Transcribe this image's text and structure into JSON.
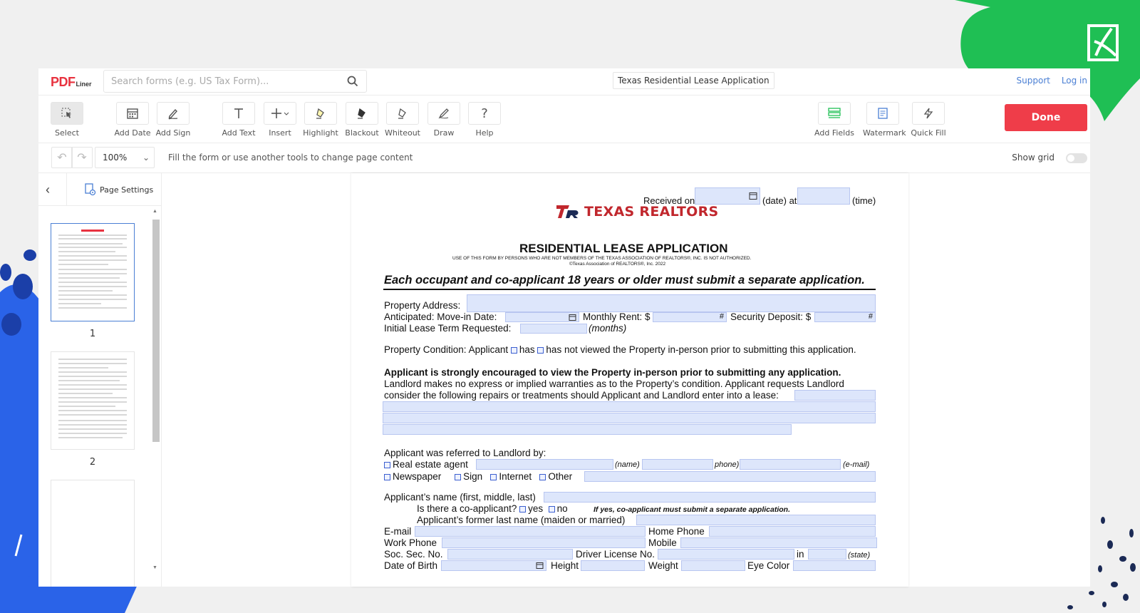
{
  "app": {
    "logo_main": "PDF",
    "logo_sub": "Liner",
    "search_placeholder": "Search forms (e.g. US Tax Form)...",
    "doc_title": "Texas Residential Lease Application",
    "links": [
      "Support",
      "Log in"
    ]
  },
  "toolbar": {
    "tools": [
      {
        "label": "Select",
        "icon": "select-icon"
      },
      {
        "label": "Add Date",
        "icon": "calendar-icon"
      },
      {
        "label": "Add Sign",
        "icon": "sign-icon"
      },
      {
        "label": "Add Text",
        "icon": "text-icon"
      },
      {
        "label": "Insert",
        "icon": "plus-icon"
      },
      {
        "label": "Highlight",
        "icon": "highlight-icon"
      },
      {
        "label": "Blackout",
        "icon": "blackout-icon"
      },
      {
        "label": "Whiteout",
        "icon": "whiteout-icon"
      },
      {
        "label": "Draw",
        "icon": "draw-icon"
      },
      {
        "label": "Help",
        "icon": "help-icon"
      },
      {
        "label": "Add Fields",
        "icon": "fields-icon"
      },
      {
        "label": "Watermark",
        "icon": "watermark-icon"
      },
      {
        "label": "Quick Fill",
        "icon": "lightning-icon"
      }
    ],
    "done_label": "Done"
  },
  "subbar": {
    "zoom": "100%",
    "hint": "Fill the form or use another tools to change page content",
    "show_grid_label": "Show grid",
    "show_grid_on": false
  },
  "sidebar": {
    "page_settings_label": "Page Settings",
    "pages": [
      "1",
      "2"
    ],
    "active_page": "1"
  },
  "document": {
    "received_on": "Received on",
    "date_label": "(date) at",
    "time_label": "(time)",
    "brand": "TEXAS REALTORS",
    "title": "RESIDENTIAL LEASE APPLICATION",
    "use_notice": "USE OF THIS FORM BY PERSONS WHO ARE NOT MEMBERS OF THE TEXAS ASSOCIATION OF REALTORS®, INC. IS NOT AUTHORIZED.",
    "copyright": "©Texas Association of REALTORS®, Inc. 2022",
    "headline": "Each occupant and co-applicant 18 years or older must submit a separate application.",
    "property_address": "Property Address:",
    "anticipated": "Anticipated:  Move-in Date:",
    "monthly_rent": "Monthly Rent: $",
    "security_deposit": "Security Deposit: $",
    "initial_term": "Initial Lease Term Requested:",
    "months": "(months)",
    "condition_a": "Property Condition: Applicant",
    "condition_has": "has",
    "condition_b": "has not viewed the Property in-person prior to submitting this application.",
    "encourage_bold": "Applicant is strongly encouraged to view the Property in-person prior to submitting any application.",
    "encourage_2": "Landlord makes no express or implied warranties as to the Property’s condition. Applicant requests Landlord",
    "encourage_3": "consider the following repairs or treatments should Applicant and Landlord enter into a lease:",
    "referred": "Applicant was referred to Landlord by:",
    "real_estate_agent": "Real estate agent",
    "name_lbl": "(name)",
    "phone_lbl": "phone)",
    "email_lbl": "(e-mail)",
    "newspaper": "Newspaper",
    "sign": "Sign",
    "internet": "Internet",
    "other": "Other",
    "applicant_name": "Applicant’s name (first, middle, last)",
    "coapplicant": "Is there a co-applicant?",
    "yes": "yes",
    "no": "no",
    "coapplicant_note": "If yes, co-applicant must submit a separate application.",
    "former_name": "Applicant’s former last name (maiden or married)",
    "email": "E-mail",
    "home_phone": "Home Phone",
    "work_phone": "Work Phone",
    "mobile": "Mobile",
    "ssn": "Soc. Sec. No.",
    "dl": "Driver License No.",
    "in": "in",
    "state": "(state)",
    "dob": "Date of Birth",
    "height": "Height",
    "weight": "Weight",
    "eye_color": "Eye Color"
  },
  "colors": {
    "accent_red": "#ef3d49",
    "brand_green": "#1fbf54",
    "brand_blue": "#2a63e8",
    "field_blue": "#dde6fb"
  }
}
